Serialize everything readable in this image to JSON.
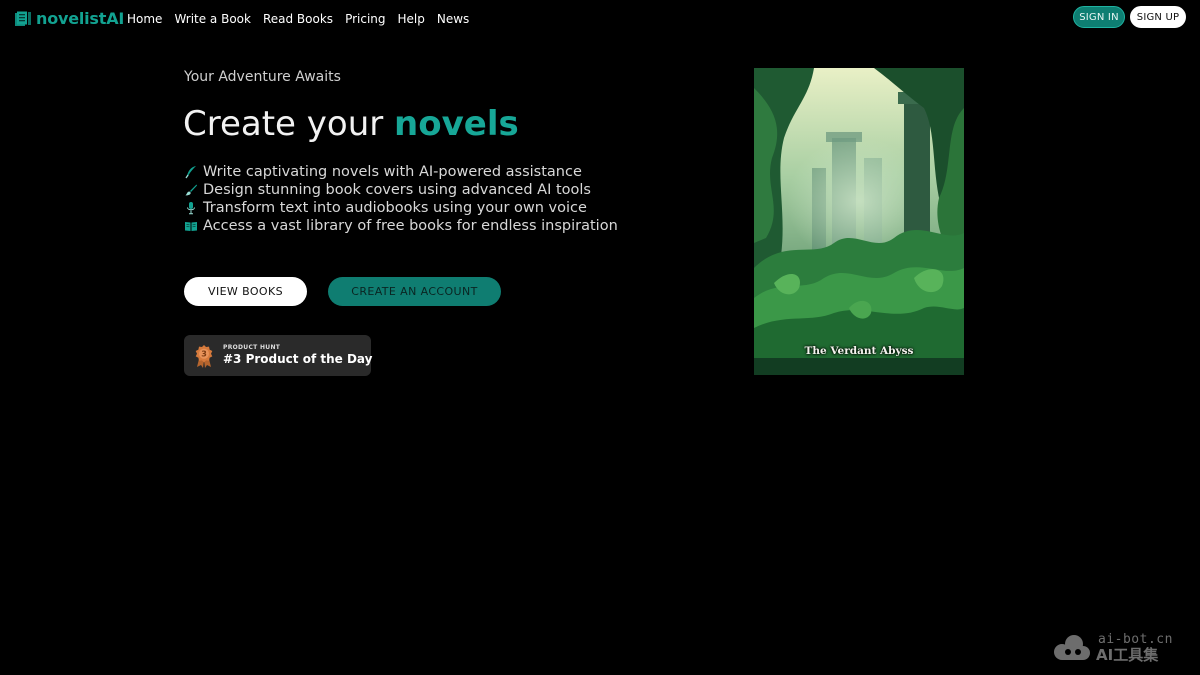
{
  "brand": {
    "name": "novelistAI",
    "accent_color": "#17a797"
  },
  "nav": {
    "items": [
      {
        "label": "Home"
      },
      {
        "label": "Write a Book"
      },
      {
        "label": "Read Books"
      },
      {
        "label": "Pricing"
      },
      {
        "label": "Help"
      },
      {
        "label": "News"
      }
    ],
    "sign_in": "SIGN IN",
    "sign_up": "SIGN UP"
  },
  "hero": {
    "eyebrow": "Your Adventure Awaits",
    "headline_prefix": "Create your ",
    "headline_accent": "novels",
    "features": [
      {
        "icon": "quill-pen-icon",
        "text": "Write captivating novels with AI-powered assistance"
      },
      {
        "icon": "paintbrush-icon",
        "text": "Design stunning book covers using advanced AI tools"
      },
      {
        "icon": "microphone-icon",
        "text": "Transform text into audiobooks using your own voice"
      },
      {
        "icon": "open-book-icon",
        "text": "Access a vast library of free books for endless inspiration"
      }
    ],
    "view_books": "VIEW BOOKS",
    "create_account": "CREATE AN ACCOUNT",
    "product_hunt": {
      "label": "PRODUCT HUNT",
      "rank": "3",
      "text": "#3 Product of the Day"
    }
  },
  "cover": {
    "title": "The Verdant Abyss"
  },
  "watermark": {
    "url": "ai-bot.cn",
    "name": "AI工具集"
  }
}
